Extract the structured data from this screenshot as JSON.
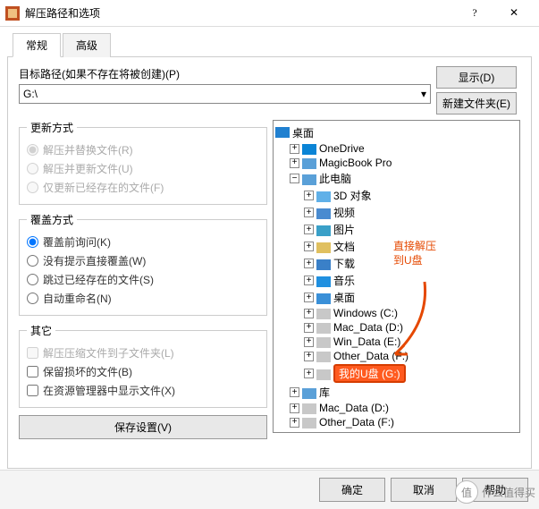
{
  "window": {
    "title": "解压路径和选项",
    "help_icon": "?",
    "close_icon": "✕"
  },
  "tabs": {
    "general": "常规",
    "advanced": "高级"
  },
  "path": {
    "label": "目标路径(如果不存在将被创建)(P)",
    "value": "G:\\",
    "dropdown": "▾"
  },
  "buttons": {
    "display": "显示(D)",
    "newfolder": "新建文件夹(E)",
    "save": "保存设置(V)",
    "ok": "确定",
    "cancel": "取消",
    "help": "帮助"
  },
  "update": {
    "legend": "更新方式",
    "o1": "解压并替换文件(R)",
    "o2": "解压并更新文件(U)",
    "o3": "仅更新已经存在的文件(F)"
  },
  "overwrite": {
    "legend": "覆盖方式",
    "o1": "覆盖前询问(K)",
    "o2": "没有提示直接覆盖(W)",
    "o3": "跳过已经存在的文件(S)",
    "o4": "自动重命名(N)"
  },
  "misc": {
    "legend": "其它",
    "o1": "解压压缩文件到子文件夹(L)",
    "o2": "保留损坏的文件(B)",
    "o3": "在资源管理器中显示文件(X)"
  },
  "tree": {
    "root": "桌面",
    "items": [
      {
        "label": "OneDrive",
        "icon": "#0a84d6",
        "exp": "+",
        "ind": 1
      },
      {
        "label": "MagicBook Pro",
        "icon": "#5aa0d8",
        "exp": "+",
        "ind": 1
      },
      {
        "label": "此电脑",
        "icon": "#5aa0d8",
        "exp": "−",
        "ind": 1
      },
      {
        "label": "3D 对象",
        "icon": "#60b0e8",
        "exp": "+",
        "ind": 2
      },
      {
        "label": "视频",
        "icon": "#4a8bd0",
        "exp": "+",
        "ind": 2
      },
      {
        "label": "图片",
        "icon": "#3aa0c8",
        "exp": "+",
        "ind": 2
      },
      {
        "label": "文档",
        "icon": "#e0c060",
        "exp": "+",
        "ind": 2
      },
      {
        "label": "下载",
        "icon": "#3a80c8",
        "exp": "+",
        "ind": 2
      },
      {
        "label": "音乐",
        "icon": "#2090e0",
        "exp": "+",
        "ind": 2
      },
      {
        "label": "桌面",
        "icon": "#3a90d8",
        "exp": "+",
        "ind": 2
      },
      {
        "label": "Windows (C:)",
        "icon": "#c8c8c8",
        "exp": "+",
        "ind": 2
      },
      {
        "label": "Mac_Data (D:)",
        "icon": "#c8c8c8",
        "exp": "+",
        "ind": 2
      },
      {
        "label": "Win_Data (E:)",
        "icon": "#c8c8c8",
        "exp": "+",
        "ind": 2
      },
      {
        "label": "Other_Data (F:)",
        "icon": "#c8c8c8",
        "exp": "+",
        "ind": 2
      },
      {
        "label": "我的U盘 (G:)",
        "icon": "#c8c8c8",
        "exp": "+",
        "ind": 2,
        "selected": true
      },
      {
        "label": "库",
        "icon": "#5aa0d8",
        "exp": "+",
        "ind": 1
      },
      {
        "label": "Mac_Data (D:)",
        "icon": "#c8c8c8",
        "exp": "+",
        "ind": 1
      },
      {
        "label": "Other_Data (F:)",
        "icon": "#c8c8c8",
        "exp": "+",
        "ind": 1
      }
    ]
  },
  "annotation": {
    "line1": "直接解压",
    "line2": "到U盘"
  },
  "watermark": {
    "icon": "值",
    "text": "什么值得买"
  }
}
